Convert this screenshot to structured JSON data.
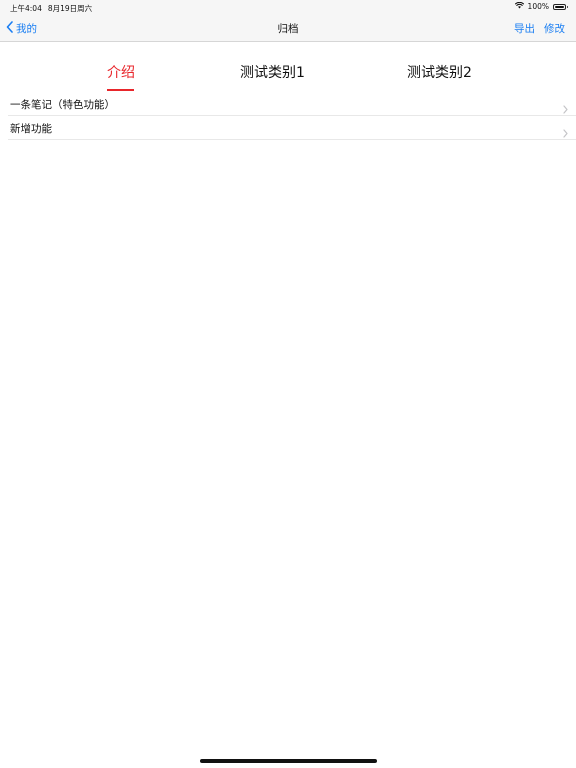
{
  "status_bar": {
    "time": "上午4:04",
    "date": "8月19日周六",
    "battery": "100%",
    "battery_level": 1.0,
    "wifi_icon": "wifi-icon",
    "battery_icon": "battery-icon"
  },
  "nav": {
    "back_label": "我的",
    "back_icon": "chevron-left-icon",
    "title": "归档",
    "export_label": "导出",
    "edit_label": "修改",
    "accent_color": "#1a7ef2"
  },
  "tabs": {
    "items": [
      {
        "label": "介绍",
        "active": true
      },
      {
        "label": "测试类别1",
        "active": false
      },
      {
        "label": "测试类别2",
        "active": false
      }
    ],
    "active_color": "#e8262b"
  },
  "list": {
    "items": [
      {
        "label": "一条笔记（特色功能）",
        "icon": "chevron-right-icon"
      },
      {
        "label": "新增功能",
        "icon": "chevron-right-icon"
      }
    ]
  }
}
